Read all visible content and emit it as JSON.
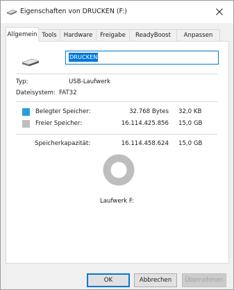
{
  "window": {
    "title": "Eigenschaften von DRUCKEN (F:)",
    "title_icon": "usb-drive-icon",
    "close_icon": "close-icon"
  },
  "tabs": [
    {
      "label": "Allgemein",
      "active": true
    },
    {
      "label": "Tools",
      "active": false
    },
    {
      "label": "Hardware",
      "active": false
    },
    {
      "label": "Freigabe",
      "active": false
    },
    {
      "label": "ReadyBoost",
      "active": false
    },
    {
      "label": "Anpassen",
      "active": false
    }
  ],
  "general": {
    "drive_icon": "usb-drive-icon",
    "name_value": "DRUCKEN",
    "type_label": "Typ:",
    "type_value": "USB-Laufwerk",
    "filesystem_label": "Dateisystem:",
    "filesystem_value": "FAT32"
  },
  "space": {
    "used": {
      "label": "Belegter Speicher:",
      "bytes": "32.768 Bytes",
      "size": "32,0 KB",
      "color": "#26a0da"
    },
    "free": {
      "label": "Freier Speicher:",
      "bytes": "16.114.425.856",
      "size": "15,0 GB",
      "color": "#bebebe"
    },
    "capacity": {
      "label": "Speicherkapazität:",
      "bytes": "16.114.458.624",
      "size": "15,0 GB"
    },
    "used_fraction": 2e-06,
    "drive_label": "Laufwerk F:"
  },
  "buttons": {
    "ok": "OK",
    "cancel": "Abbrechen",
    "apply": "Übernehmen"
  }
}
